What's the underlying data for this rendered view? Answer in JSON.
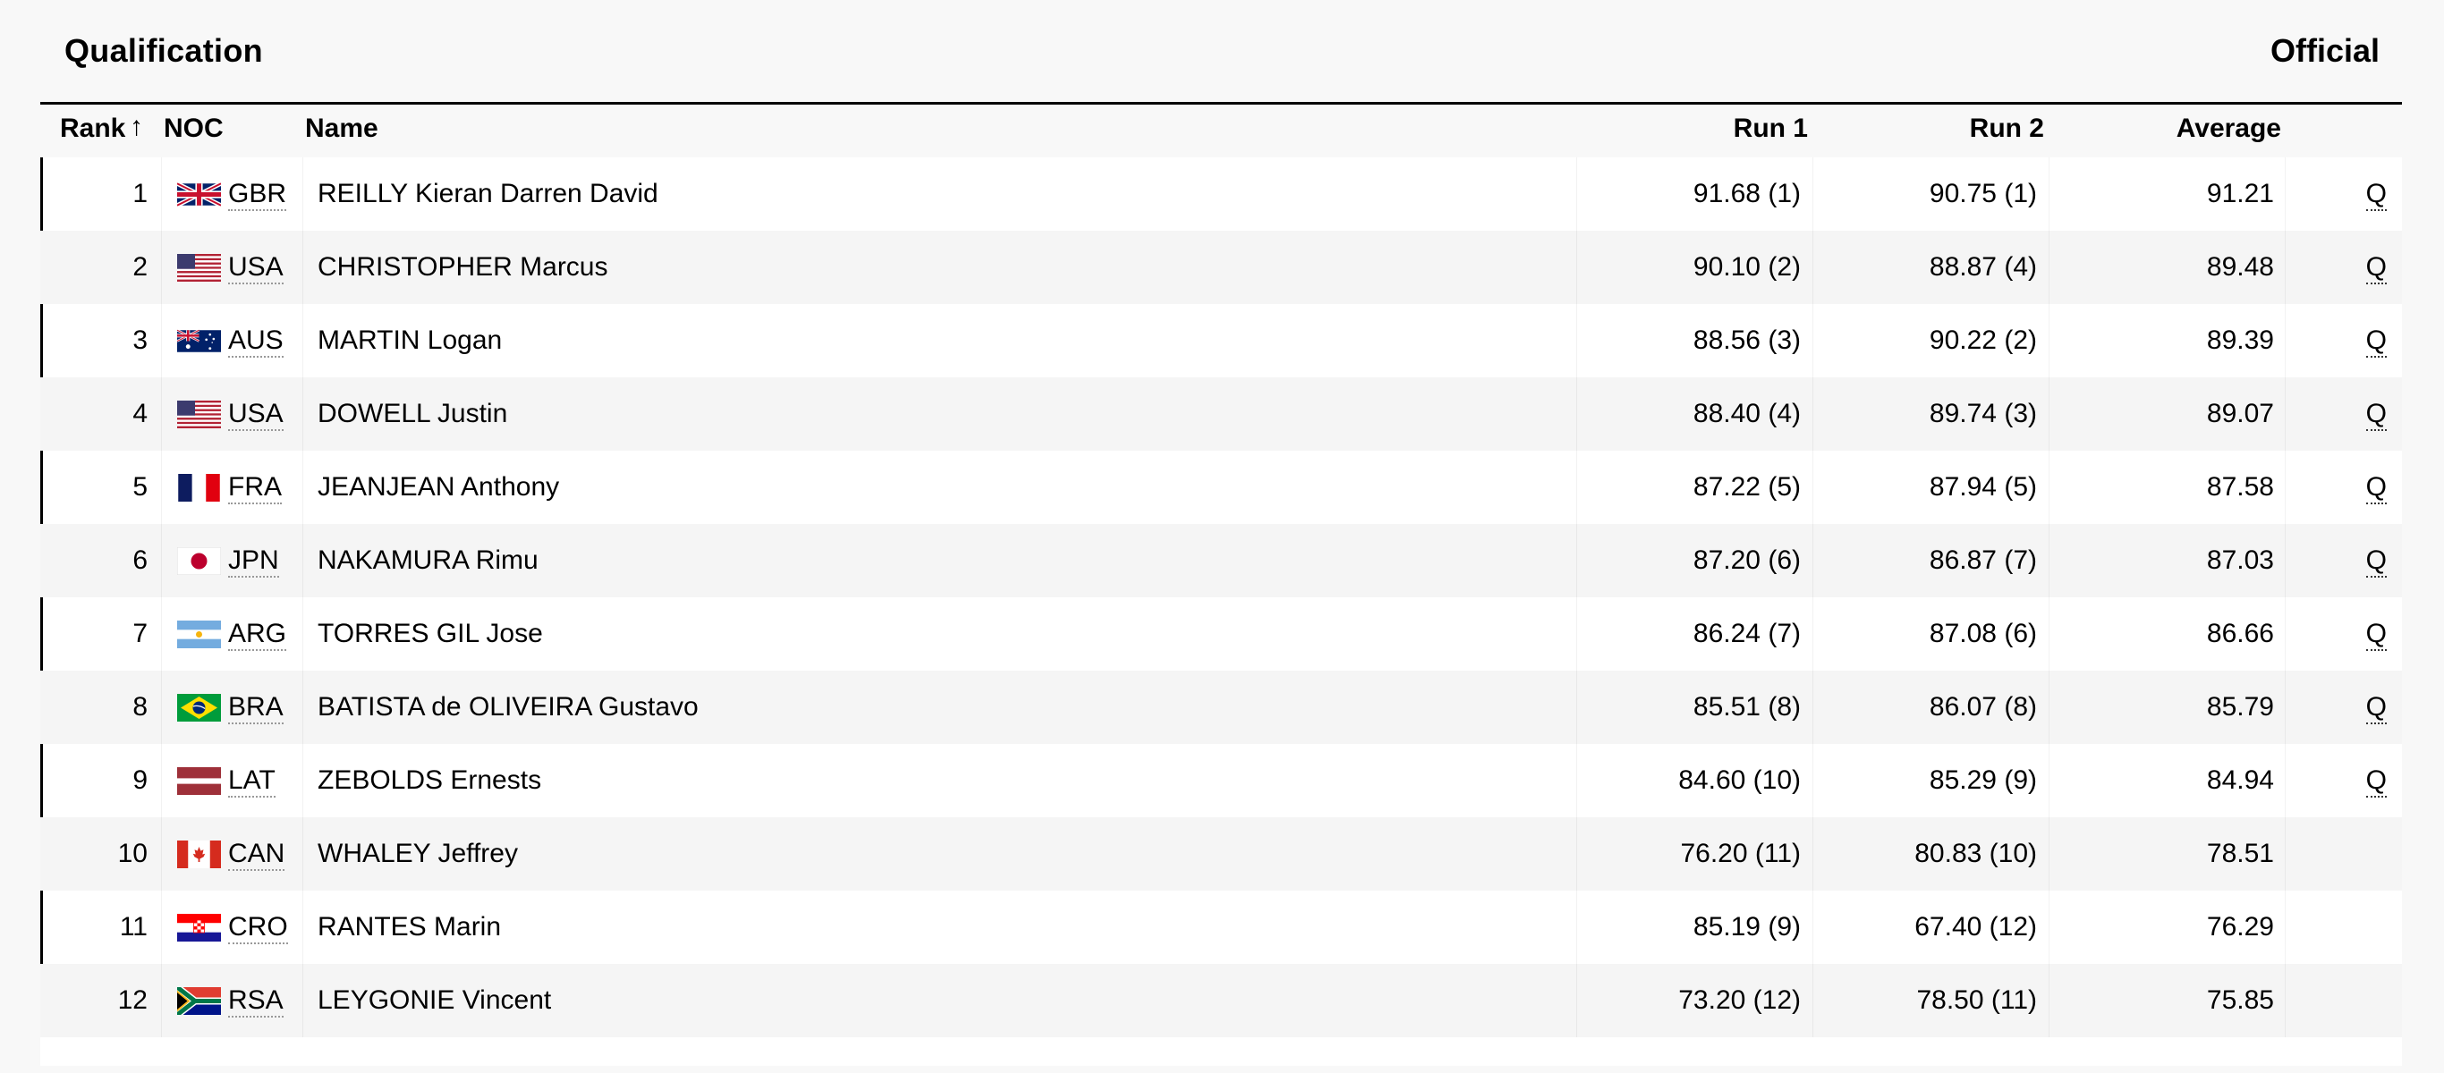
{
  "header": {
    "title": "Qualification",
    "status": "Official"
  },
  "columns": {
    "rank": "Rank",
    "sort_icon": "↑",
    "noc": "NOC",
    "name": "Name",
    "run1": "Run 1",
    "run2": "Run 2",
    "average": "Average"
  },
  "rows": [
    {
      "rank": "1",
      "noc": "GBR",
      "flag": "gbr",
      "name": "REILLY Kieran Darren David",
      "run1": "91.68 (1)",
      "run2": "90.75 (1)",
      "average": "91.21",
      "q": "Q"
    },
    {
      "rank": "2",
      "noc": "USA",
      "flag": "usa",
      "name": "CHRISTOPHER Marcus",
      "run1": "90.10 (2)",
      "run2": "88.87 (4)",
      "average": "89.48",
      "q": "Q"
    },
    {
      "rank": "3",
      "noc": "AUS",
      "flag": "aus",
      "name": "MARTIN Logan",
      "run1": "88.56 (3)",
      "run2": "90.22 (2)",
      "average": "89.39",
      "q": "Q"
    },
    {
      "rank": "4",
      "noc": "USA",
      "flag": "usa",
      "name": "DOWELL Justin",
      "run1": "88.40 (4)",
      "run2": "89.74 (3)",
      "average": "89.07",
      "q": "Q"
    },
    {
      "rank": "5",
      "noc": "FRA",
      "flag": "fra",
      "name": "JEANJEAN Anthony",
      "run1": "87.22 (5)",
      "run2": "87.94 (5)",
      "average": "87.58",
      "q": "Q"
    },
    {
      "rank": "6",
      "noc": "JPN",
      "flag": "jpn",
      "name": "NAKAMURA Rimu",
      "run1": "87.20 (6)",
      "run2": "86.87 (7)",
      "average": "87.03",
      "q": "Q"
    },
    {
      "rank": "7",
      "noc": "ARG",
      "flag": "arg",
      "name": "TORRES GIL Jose",
      "run1": "86.24 (7)",
      "run2": "87.08 (6)",
      "average": "86.66",
      "q": "Q"
    },
    {
      "rank": "8",
      "noc": "BRA",
      "flag": "bra",
      "name": "BATISTA de OLIVEIRA Gustavo",
      "run1": "85.51 (8)",
      "run2": "86.07 (8)",
      "average": "85.79",
      "q": "Q"
    },
    {
      "rank": "9",
      "noc": "LAT",
      "flag": "lat",
      "name": "ZEBOLDS Ernests",
      "run1": "84.60 (10)",
      "run2": "85.29 (9)",
      "average": "84.94",
      "q": "Q"
    },
    {
      "rank": "10",
      "noc": "CAN",
      "flag": "can",
      "name": "WHALEY Jeffrey",
      "run1": "76.20 (11)",
      "run2": "80.83 (10)",
      "average": "78.51",
      "q": ""
    },
    {
      "rank": "11",
      "noc": "CRO",
      "flag": "cro",
      "name": "RANTES Marin",
      "run1": "85.19 (9)",
      "run2": "67.40 (12)",
      "average": "76.29",
      "q": ""
    },
    {
      "rank": "12",
      "noc": "RSA",
      "flag": "rsa",
      "name": "LEYGONIE Vincent",
      "run1": "73.20 (12)",
      "run2": "78.50 (11)",
      "average": "75.85",
      "q": ""
    }
  ]
}
